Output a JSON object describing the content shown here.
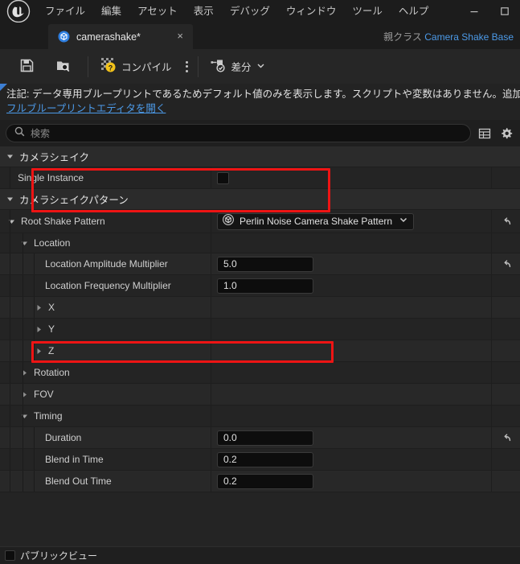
{
  "window": {
    "menu_items": [
      "ファイル",
      "編集",
      "アセット",
      "表示",
      "デバッグ",
      "ウィンドウ",
      "ツール",
      "ヘルプ"
    ],
    "minimize_label": "—",
    "maximize_label": "□"
  },
  "tab": {
    "title": "camerashake*",
    "close_label": "×",
    "parent_class_label": "親クラス",
    "parent_class_value": "Camera Shake Base"
  },
  "toolbar": {
    "save_label": "",
    "browse_label": "",
    "compile_label": "コンパイル",
    "diff_label": "差分"
  },
  "notice": {
    "text": "注記:  データ専用ブループリントであるためデフォルト値のみを表示します。スクリプトや変数はありません。追加",
    "link": "フルブループリントエディタを開く"
  },
  "search": {
    "placeholder": "検索"
  },
  "footer": {
    "public_view_label": "パブリックビュー"
  },
  "colors": {
    "accent_blue": "#4c9ae8",
    "highlight_red": "#ee1414",
    "compile_badge": "#f2c21a"
  },
  "tree": {
    "rows": [
      {
        "label": "カメラシェイク",
        "kind": "category",
        "indent": 0,
        "expanded": true
      },
      {
        "label": "Single Instance",
        "kind": "checkbox",
        "indent": 1,
        "checked": false
      },
      {
        "label": "カメラシェイクパターン",
        "kind": "category",
        "indent": 0,
        "expanded": true
      },
      {
        "label": "Root Shake Pattern",
        "kind": "combo",
        "indent": 1,
        "expanded": true,
        "value": "Perlin Noise Camera Shake Pattern",
        "reset": true
      },
      {
        "label": "Location",
        "kind": "group",
        "indent": 2,
        "expanded": true
      },
      {
        "label": "Location Amplitude Multiplier",
        "kind": "number",
        "indent": 3,
        "value": "5.0",
        "reset": true
      },
      {
        "label": "Location Frequency Multiplier",
        "kind": "number",
        "indent": 3,
        "value": "1.0"
      },
      {
        "label": "X",
        "kind": "group",
        "indent": 3,
        "expanded": false
      },
      {
        "label": "Y",
        "kind": "group",
        "indent": 3,
        "expanded": false
      },
      {
        "label": "Z",
        "kind": "group",
        "indent": 3,
        "expanded": false
      },
      {
        "label": "Rotation",
        "kind": "group",
        "indent": 2,
        "expanded": false
      },
      {
        "label": "FOV",
        "kind": "group",
        "indent": 2,
        "expanded": false
      },
      {
        "label": "Timing",
        "kind": "group",
        "indent": 2,
        "expanded": true
      },
      {
        "label": "Duration",
        "kind": "number",
        "indent": 3,
        "value": "0.0",
        "reset": true
      },
      {
        "label": "Blend in Time",
        "kind": "number",
        "indent": 3,
        "value": "0.2"
      },
      {
        "label": "Blend Out Time",
        "kind": "number",
        "indent": 3,
        "value": "0.2"
      }
    ]
  }
}
